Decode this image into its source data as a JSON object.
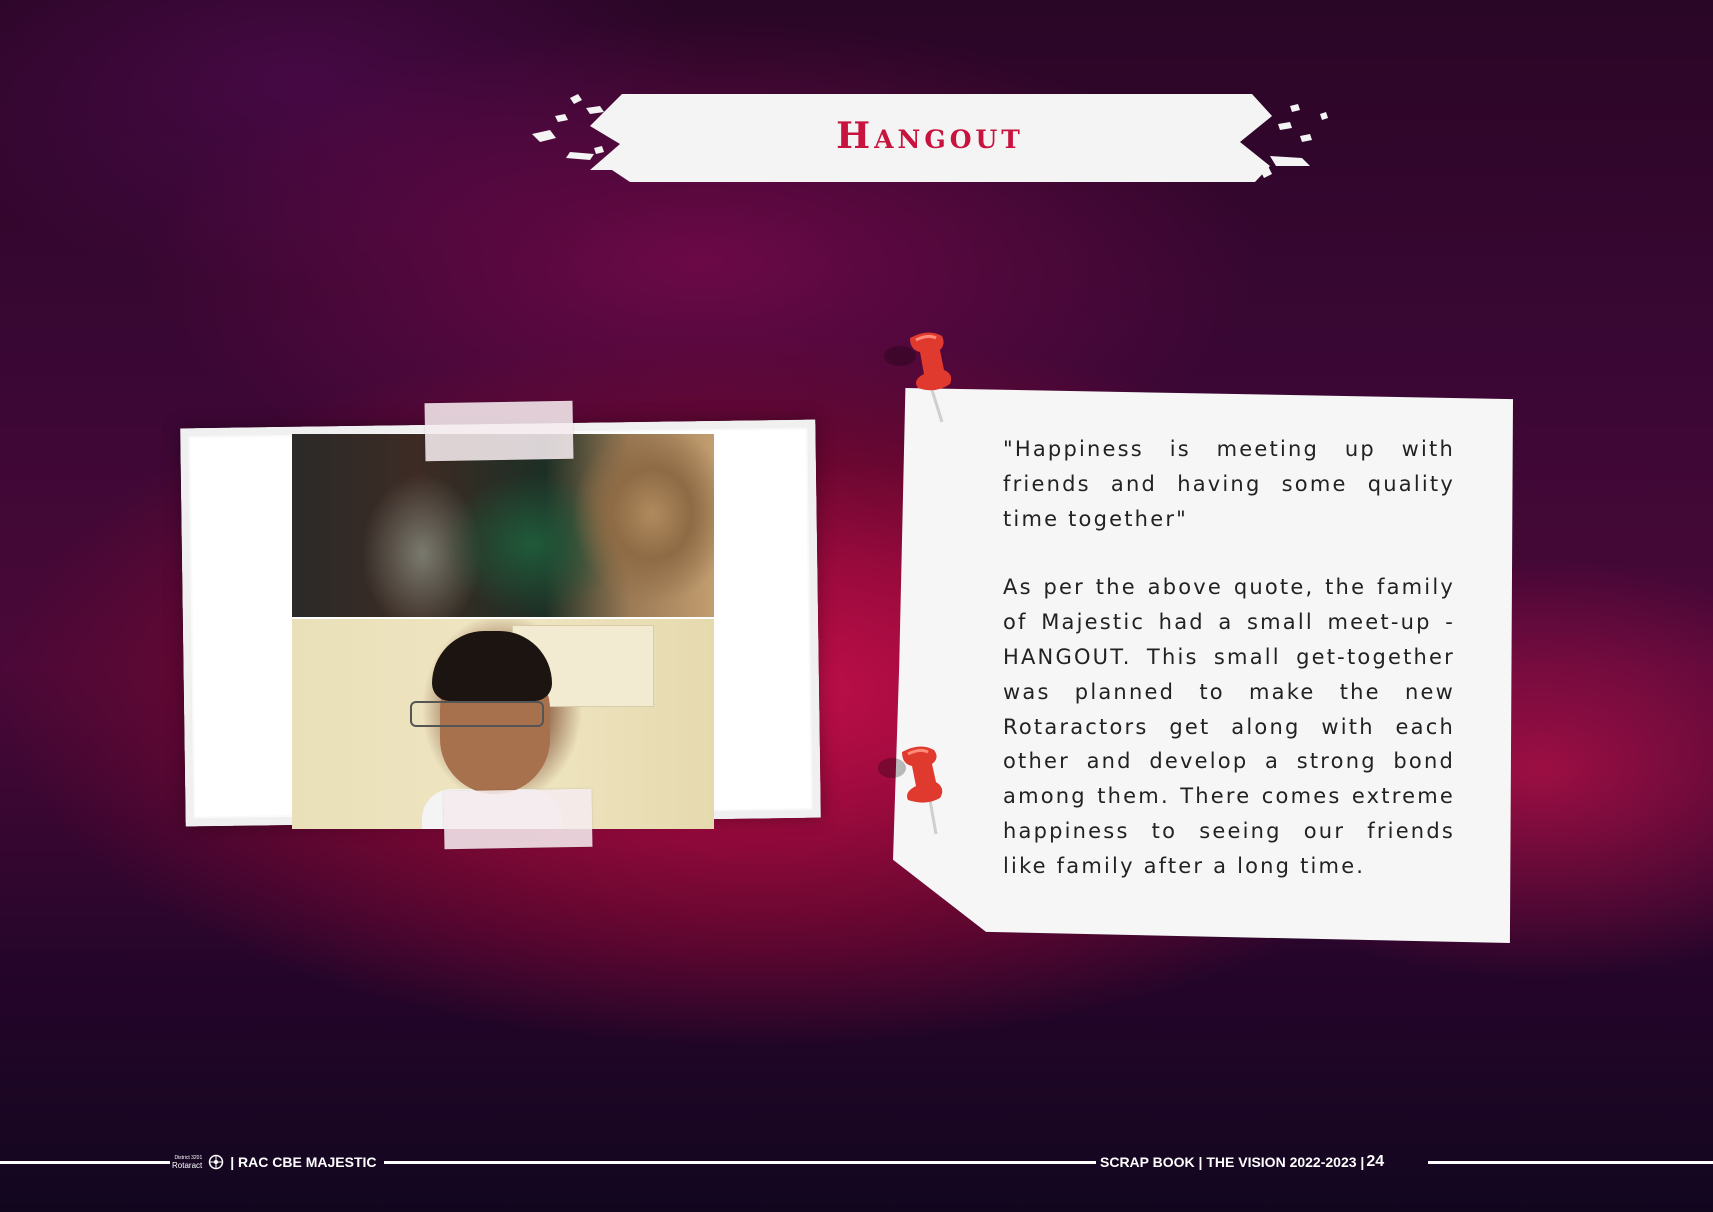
{
  "header": {
    "title": "Hangout"
  },
  "note": {
    "quote": "\"Happiness is meeting up with friends and having some quality time together\"",
    "body": "As per the above quote, the family of Majestic had a small meet-up - HANGOUT. This small get-together was planned to make the new Rotaractors get along with each other and develop a strong bond among them. There comes extreme happiness to seeing our friends like family after a long time."
  },
  "footer": {
    "logo_district": "District 3201",
    "logo_name": "Rotaract",
    "club": "| RAC CBE MAJESTIC",
    "publication": "SCRAP BOOK | THE VISION 2022-2023 |",
    "page": "24"
  },
  "colors": {
    "accent": "#c8133f",
    "note_bg": "#f6f6f6",
    "pin": "#e03a2e"
  },
  "icons": [
    "pushpin-icon",
    "rotaract-wheel-icon"
  ]
}
